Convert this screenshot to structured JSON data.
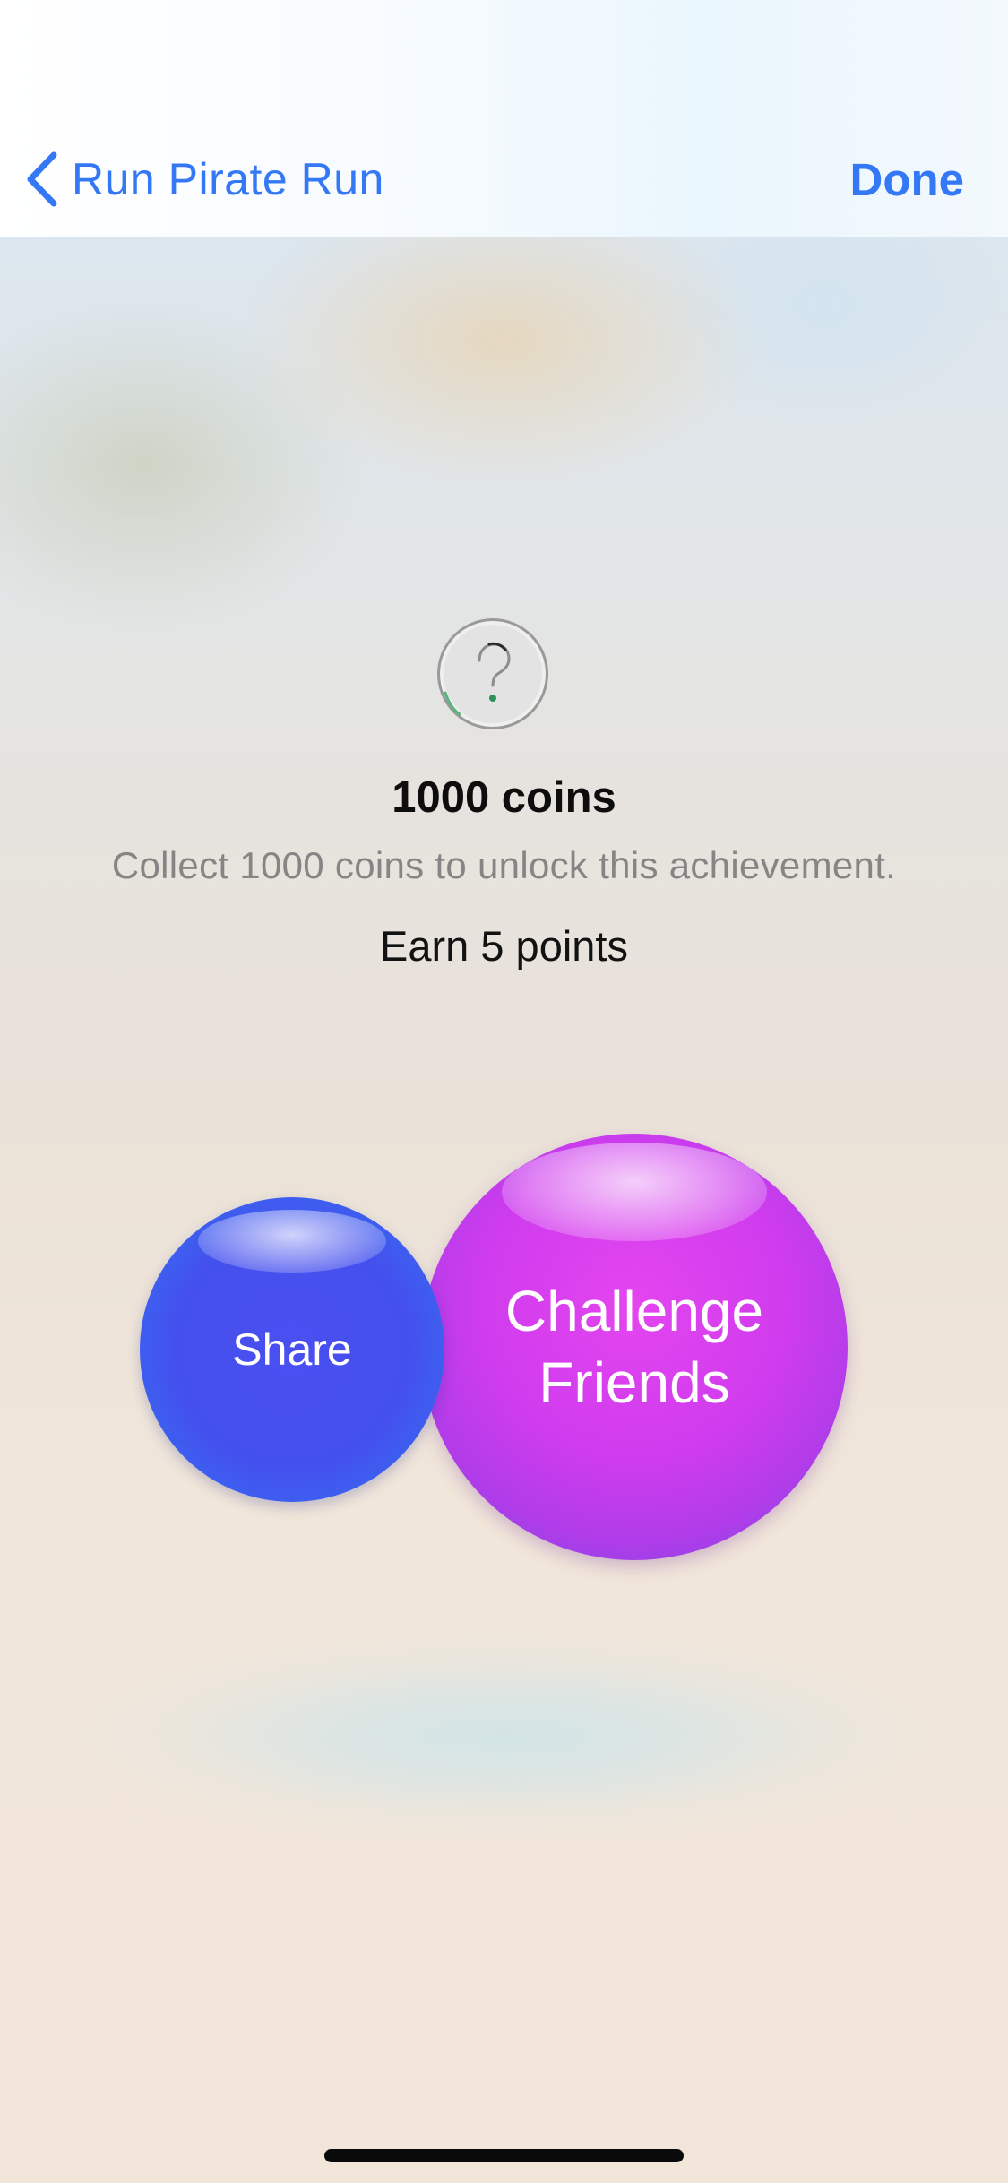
{
  "navbar": {
    "back_label": "Run Pirate Run",
    "done_label": "Done",
    "accent_color": "#3478f6"
  },
  "badge": {
    "icon": "question-mark-icon"
  },
  "achievement": {
    "title": "1000 coins",
    "description": "Collect 1000 coins to unlock this achievement.",
    "points": "Earn 5 points"
  },
  "actions": {
    "share_label": "Share",
    "challenge_line1": "Challenge",
    "challenge_line2": "Friends",
    "share_color": "#4450ee",
    "challenge_color": "#d03cee"
  }
}
